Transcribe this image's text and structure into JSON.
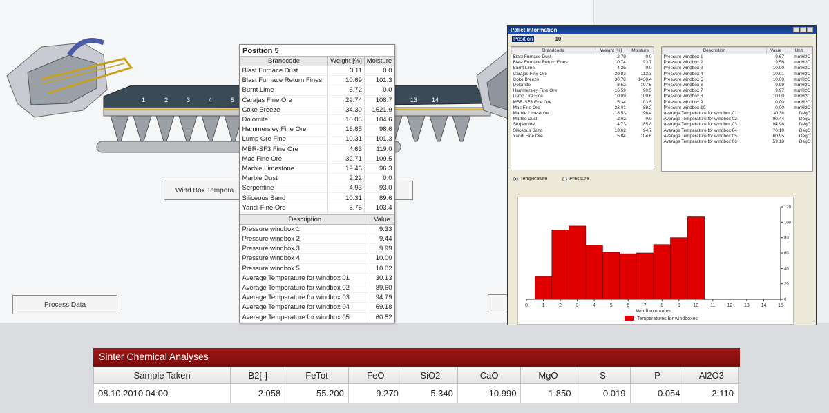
{
  "buttons": {
    "wind_box": "Wind Box Tempera",
    "process_data": "Process Data"
  },
  "plant": {
    "windbox_numbers": [
      "1",
      "2",
      "3",
      "4",
      "5",
      "13",
      "14"
    ]
  },
  "position5": {
    "title": "Position 5",
    "material_headers": [
      "Brandcode",
      "Weight [%]",
      "Moisture"
    ],
    "materials": [
      [
        "Blast Furnace Dust",
        "3.11",
        "0.0"
      ],
      [
        "Blast Furnace Return Fines",
        "10.69",
        "101.3"
      ],
      [
        "Burnt Lime",
        "5.72",
        "0.0"
      ],
      [
        "Carajas Fine Ore",
        "29.74",
        "108.7"
      ],
      [
        "Coke Breeze",
        "34.30",
        "1521.9"
      ],
      [
        "Dolomite",
        "10.05",
        "104.6"
      ],
      [
        "Hammersley Fine Ore",
        "16.85",
        "98.6"
      ],
      [
        "Lump Ore Fine",
        "10.31",
        "101.3"
      ],
      [
        "MBR-SF3 Fine Ore",
        "4.63",
        "119.0"
      ],
      [
        "Mac Fine Ore",
        "32.71",
        "109.5"
      ],
      [
        "Marble Limestone",
        "19.46",
        "96.3"
      ],
      [
        "Marble Dust",
        "2.22",
        "0.0"
      ],
      [
        "Serpentine",
        "4.93",
        "93.0"
      ],
      [
        "Siliceous Sand",
        "10.31",
        "89.6"
      ],
      [
        "Yandi Fine Ore",
        "5.75",
        "103.4"
      ]
    ],
    "desc_headers": [
      "Description",
      "Value"
    ],
    "descriptions": [
      [
        "Pressure windbox 1",
        "9.33"
      ],
      [
        "Pressure windbox 2",
        "9.44"
      ],
      [
        "Pressure windbox 3",
        "9.99"
      ],
      [
        "Pressure windbox 4",
        "10.00"
      ],
      [
        "Pressure windbox 5",
        "10.02"
      ],
      [
        "Average Temperature for windbox 01",
        "30.13"
      ],
      [
        "Average Temperature for windbox 02",
        "89.60"
      ],
      [
        "Average Temperature for windbox 03",
        "94.79"
      ],
      [
        "Average Temperature for windbox 04",
        "69.18"
      ],
      [
        "Average Temperature for windbox 05",
        "60.52"
      ]
    ]
  },
  "pallet": {
    "title": "Pallet Information",
    "position_label": "Position",
    "position_value": "10",
    "material_headers": [
      "Brandcode",
      "Weight [%]",
      "Moisture"
    ],
    "materials": [
      [
        "Blast Furnace Dust",
        "2.79",
        "0.0"
      ],
      [
        "Blast Furnace Return Fines",
        "10.74",
        "93.7"
      ],
      [
        "Burnt Lime",
        "4.25",
        "0.0"
      ],
      [
        "Carajas Fine Ore",
        "29.83",
        "113.3"
      ],
      [
        "Coke Breeze",
        "30.78",
        "1430.4"
      ],
      [
        "Dolomite",
        "8.52",
        "107.5"
      ],
      [
        "Hammersley Fine Ore",
        "16.59",
        "90.5"
      ],
      [
        "Lump Ore Fine",
        "10.09",
        "100.6"
      ],
      [
        "MBR-SF3 Fine Ore",
        "5.34",
        "103.5"
      ],
      [
        "Mac Fine Ore",
        "33.01",
        "89.2"
      ],
      [
        "Marble Limestone",
        "18.53",
        "96.4"
      ],
      [
        "Marble Dust",
        "2.02",
        "0.0"
      ],
      [
        "Serpentine",
        "4.73",
        "85.8"
      ],
      [
        "Siliceous Sand",
        "10.62",
        "94.7"
      ],
      [
        "Yandi Fine Ore",
        "5.84",
        "104.6"
      ]
    ],
    "desc_headers": [
      "Description",
      "Value",
      "Unit"
    ],
    "descriptions": [
      [
        "Pressure windbox 1",
        "9.67",
        "mmH2O"
      ],
      [
        "Pressure windbox 2",
        "9.56",
        "mmH2O"
      ],
      [
        "Pressure windbox 3",
        "10.00",
        "mmH2O"
      ],
      [
        "Pressure windbox 4",
        "10.01",
        "mmH2O"
      ],
      [
        "Pressure windbox 5",
        "10.00",
        "mmH2O"
      ],
      [
        "Pressure windbox 6",
        "9.99",
        "mmH2O"
      ],
      [
        "Pressure windbox 7",
        "9.97",
        "mmH2O"
      ],
      [
        "Pressure windbox 8",
        "10.00",
        "mmH2O"
      ],
      [
        "Pressure windbox 9",
        "0.00",
        "mmH2O"
      ],
      [
        "Pressure windbox 10",
        "0.00",
        "mmH2O"
      ],
      [
        "Average Temperature for windbox 01",
        "30.36",
        "DegC"
      ],
      [
        "Average Temperature for windbox 02",
        "90.44",
        "DegC"
      ],
      [
        "Average Temperature for windbox 03",
        "94.96",
        "DegC"
      ],
      [
        "Average Temperature for windbox 04",
        "70.10",
        "DegC"
      ],
      [
        "Average Temperature for windbox 05",
        "60.95",
        "DegC"
      ],
      [
        "Average Temperature for windbox 06",
        "59.18",
        "DegC"
      ]
    ],
    "radio_temperature": "Temperature",
    "radio_pressure": "Pressure",
    "temperature_selected": true
  },
  "chart_data": {
    "type": "bar",
    "x": [
      1,
      2,
      3,
      4,
      5,
      6,
      7,
      8,
      9,
      10
    ],
    "values": [
      30,
      90,
      95,
      70,
      61,
      59,
      60,
      71,
      80,
      107
    ],
    "xlabel": "Windboxnumber",
    "ylabel": "DegC",
    "xlim": [
      0,
      15
    ],
    "ylim": [
      0,
      120
    ],
    "xticks": [
      "0",
      "1",
      "2",
      "3",
      "4",
      "5",
      "6",
      "7",
      "8",
      "9",
      "10",
      "11",
      "12",
      "13",
      "14",
      "15"
    ],
    "yticks": [
      "0",
      "20",
      "40",
      "60",
      "80",
      "100",
      "120"
    ],
    "legend": "Temperatures for windboxes",
    "legend_position": "bottom",
    "bar_color": "#e00000"
  },
  "sinter": {
    "title": "Sinter Chemical Analyses",
    "headers": [
      "Sample Taken",
      "B2[-]",
      "FeTot",
      "FeO",
      "SiO2",
      "CaO",
      "MgO",
      "S",
      "P",
      "Al2O3"
    ],
    "row": [
      "08.10.2010 04:00",
      "2.058",
      "55.200",
      "9.270",
      "5.340",
      "10.990",
      "1.850",
      "0.019",
      "0.054",
      "2.110"
    ]
  },
  "colors": {
    "header_red": "#8f1111",
    "titlebar_blue": "#10347a"
  }
}
